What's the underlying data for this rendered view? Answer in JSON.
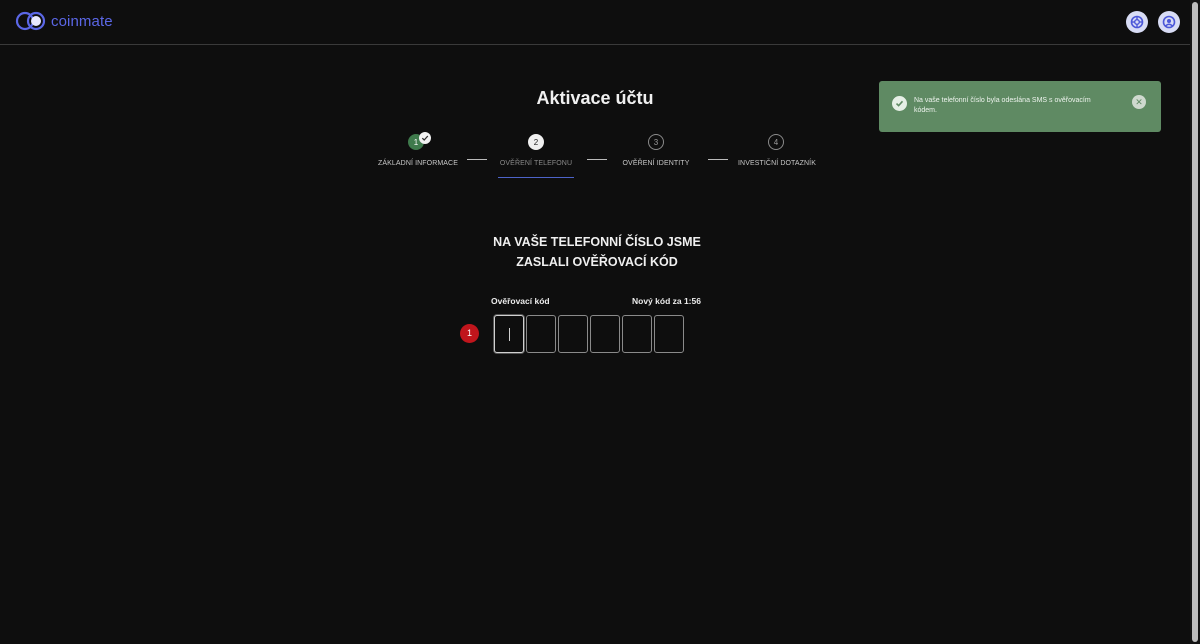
{
  "brand": {
    "name": "coinmate",
    "color": "#5b67e6"
  },
  "header": {
    "icons": [
      "help-lifebuoy-icon",
      "user-settings-icon"
    ]
  },
  "page": {
    "title": "Aktivace účtu"
  },
  "stepper": {
    "steps": [
      {
        "number": "1",
        "label": "ZÁKLADNÍ INFORMACE",
        "state": "done"
      },
      {
        "number": "2",
        "label": "OVĚŘENÍ TELEFONU",
        "state": "active"
      },
      {
        "number": "3",
        "label": "OVĚŘENÍ IDENTITY",
        "state": "pending"
      },
      {
        "number": "4",
        "label": "INVESTIČNÍ DOTAZNÍK",
        "state": "pending"
      }
    ]
  },
  "verification": {
    "heading_line1": "NA VAŠE TELEFONNÍ ČÍSLO JSME",
    "heading_line2": "ZASLALI OVĚŘOVACÍ KÓD",
    "code_label": "Ověřovací kód",
    "resend_timer": "Nový kód za 1:56",
    "badge": "1",
    "code_digits": [
      "",
      "",
      "",
      "",
      "",
      ""
    ]
  },
  "toast": {
    "message": "Na vaše telefonní číslo byla odeslána SMS s ověřovacím kódem.",
    "color": "#5f8a63"
  }
}
